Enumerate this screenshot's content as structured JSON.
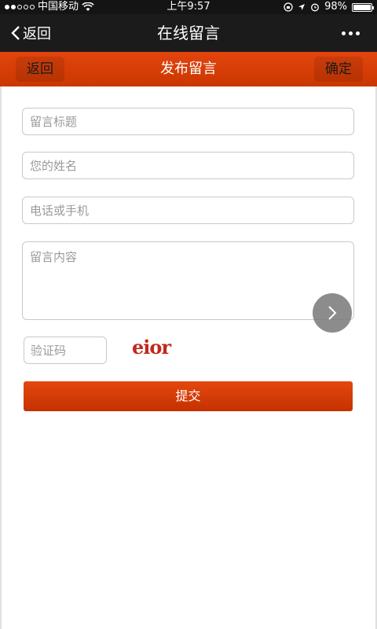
{
  "status_bar": {
    "carrier": "中国移动",
    "time": "上午9:57",
    "battery": "98%",
    "battery_level": 0.98
  },
  "nav": {
    "back_label": "返回",
    "title": "在线留言",
    "more_icon": "more-dots-icon"
  },
  "header": {
    "back_label": "返回",
    "title": "发布留言",
    "confirm_label": "确定",
    "color": "#d63e05"
  },
  "form": {
    "title_placeholder": "留言标题",
    "name_placeholder": "您的姓名",
    "phone_placeholder": "电话或手机",
    "content_placeholder": "留言内容",
    "captcha_placeholder": "验证码",
    "captcha_text": "eior",
    "submit_label": "提交"
  }
}
